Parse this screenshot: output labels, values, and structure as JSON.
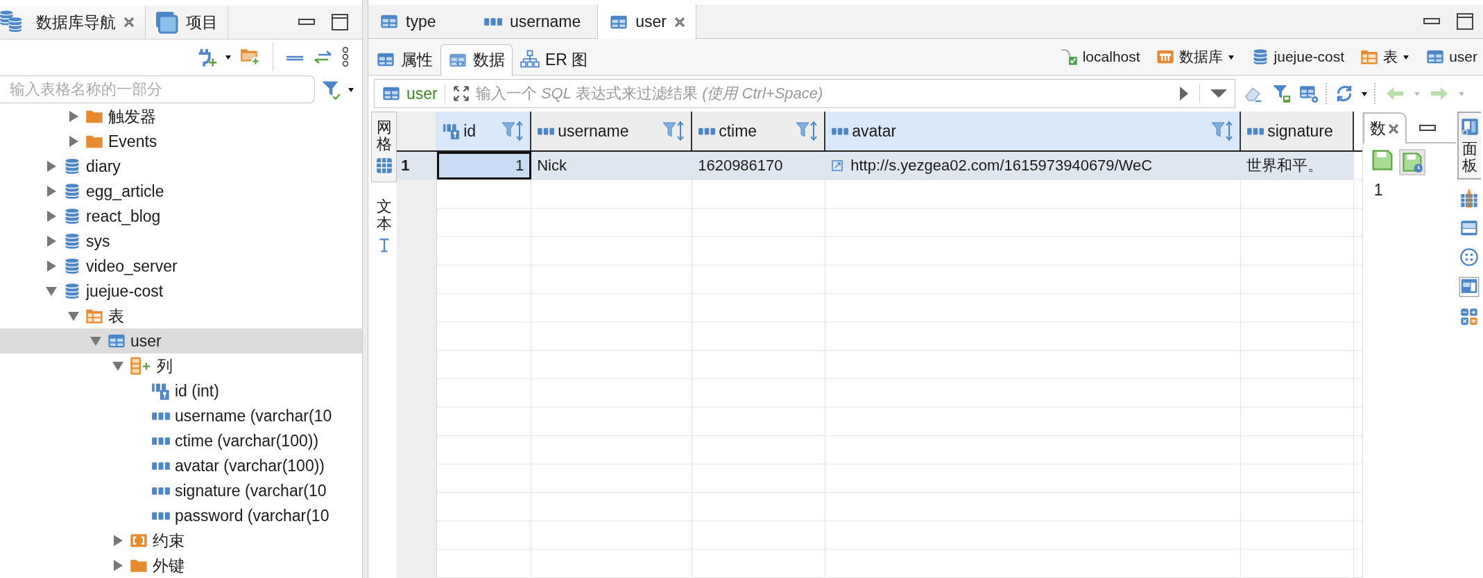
{
  "navigator": {
    "tabs": [
      {
        "label": "数据库导航",
        "kind": "databases",
        "selected": true,
        "closable": true
      },
      {
        "label": "项目",
        "kind": "project",
        "selected": false,
        "closable": false
      }
    ],
    "search": {
      "placeholder": "输入表格名称的一部分"
    },
    "tree": {
      "partial_items": [
        {
          "label": "触发器",
          "kind": "folder",
          "expanded": false,
          "selected": false
        },
        {
          "label": "Events",
          "kind": "folder",
          "expanded": false,
          "selected": false
        }
      ],
      "items": [
        {
          "label": "diary",
          "kind": "database",
          "expanded": false,
          "selected": false
        },
        {
          "label": "egg_article",
          "kind": "database",
          "expanded": false,
          "selected": false
        },
        {
          "label": "react_blog",
          "kind": "database",
          "expanded": false,
          "selected": false
        },
        {
          "label": "sys",
          "kind": "database",
          "expanded": false,
          "selected": false
        },
        {
          "label": "video_server",
          "kind": "database",
          "expanded": false,
          "selected": false
        },
        {
          "label": "juejue-cost",
          "kind": "database",
          "expanded": true,
          "selected": false,
          "children": [
            {
              "label": "表",
              "kind": "tables",
              "expanded": true,
              "selected": false,
              "children": [
                {
                  "label": "user",
                  "kind": "table",
                  "expanded": true,
                  "selected": true,
                  "children": [
                    {
                      "label": "列",
                      "kind": "columns",
                      "expanded": true,
                      "selected": false,
                      "children": [
                        {
                          "label": "id (int)",
                          "kind": "column-key",
                          "selected": false
                        },
                        {
                          "label": "username (varchar(10",
                          "kind": "column-text",
                          "selected": false
                        },
                        {
                          "label": "ctime (varchar(100))",
                          "kind": "column-text",
                          "selected": false
                        },
                        {
                          "label": "avatar (varchar(100))",
                          "kind": "column-text",
                          "selected": false
                        },
                        {
                          "label": "signature (varchar(10",
                          "kind": "column-text",
                          "selected": false
                        },
                        {
                          "label": "password (varchar(10",
                          "kind": "column-text",
                          "selected": false
                        }
                      ]
                    },
                    {
                      "label": "约束",
                      "kind": "constraints",
                      "expanded": false,
                      "selected": false
                    },
                    {
                      "label": "外键",
                      "kind": "folder",
                      "expanded": false,
                      "selected": false
                    }
                  ]
                }
              ]
            }
          ]
        }
      ]
    }
  },
  "editor": {
    "tabs": [
      {
        "label": "type",
        "kind": "table",
        "selected": false,
        "closable": false
      },
      {
        "label": "username",
        "kind": "text-column",
        "selected": false,
        "closable": false
      },
      {
        "label": "user",
        "kind": "table",
        "selected": true,
        "closable": true
      }
    ],
    "subtabs": [
      {
        "label": "属性",
        "kind": "table",
        "selected": false
      },
      {
        "label": "数据",
        "kind": "data",
        "selected": true
      },
      {
        "label": "ER 图",
        "kind": "diagram",
        "selected": false
      }
    ],
    "breadcrumb": [
      {
        "label": "localhost",
        "kind": "server",
        "dropdown": false
      },
      {
        "label": "数据库",
        "kind": "catalog",
        "dropdown": true
      },
      {
        "label": "juejue-cost",
        "kind": "database",
        "dropdown": false
      },
      {
        "label": "表",
        "kind": "tables",
        "dropdown": true
      },
      {
        "label": "user",
        "kind": "table",
        "dropdown": false
      }
    ],
    "filter": {
      "table": "user",
      "placeholder": "输入一个 *SQL* 表达式来过滤结果 *(使用 Ctrl+Space)*"
    },
    "view_tabs": [
      {
        "label": "网格",
        "kind": "grid",
        "selected": true
      },
      {
        "label": "文本",
        "kind": "text",
        "selected": false
      }
    ],
    "grid": {
      "columns": [
        {
          "name": "id",
          "kind": "number-key",
          "highlighted": true
        },
        {
          "name": "username",
          "kind": "text",
          "highlighted": false
        },
        {
          "name": "ctime",
          "kind": "text",
          "highlighted": false
        },
        {
          "name": "avatar",
          "kind": "text",
          "highlighted": true
        },
        {
          "name": "signature",
          "kind": "text",
          "highlighted": false
        }
      ],
      "rows": [
        {
          "number": "1",
          "selected": true,
          "cells": [
            {
              "text": "1",
              "focused": true,
              "link": false
            },
            {
              "text": "Nick",
              "focused": false,
              "link": false
            },
            {
              "text": "1620986170",
              "focused": false,
              "link": false
            },
            {
              "text": "http://s.yezgea02.com/1615973940679/WeC",
              "focused": false,
              "link": true
            },
            {
              "text": "世界和平。",
              "focused": false,
              "link": false
            }
          ]
        }
      ]
    }
  },
  "value_panel": {
    "tab": "数",
    "count": "1"
  },
  "side_strip": {
    "button": "面板"
  }
}
